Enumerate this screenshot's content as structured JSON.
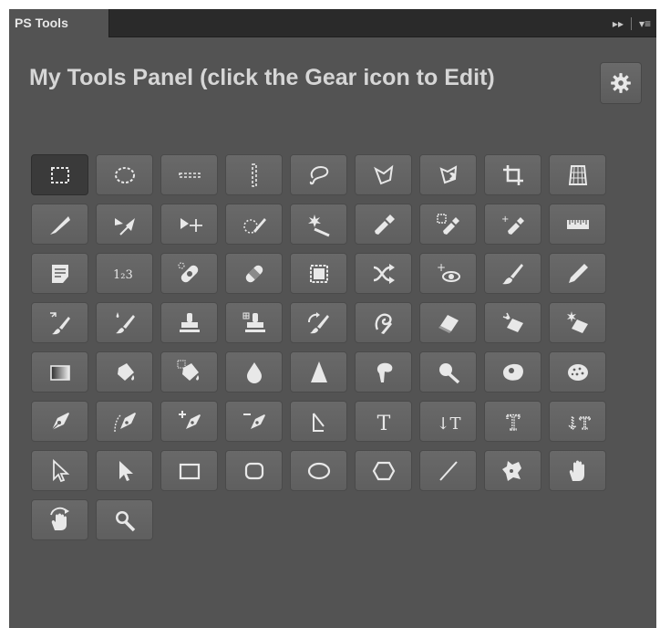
{
  "tab": {
    "label": "PS Tools"
  },
  "tab_controls": {
    "collapse_symbol": "▸▸",
    "menu_symbol": "▾≡"
  },
  "panel": {
    "title": "My Tools Panel (click the Gear icon to Edit)"
  },
  "gear_button": {
    "icon": "gear-icon"
  },
  "tools": [
    {
      "name": "rectangular-marquee",
      "icon": "rect-marquee-icon"
    },
    {
      "name": "elliptical-marquee",
      "icon": "ellipse-marquee-icon"
    },
    {
      "name": "single-row-marquee",
      "icon": "row-marquee-icon"
    },
    {
      "name": "single-column-marquee",
      "icon": "column-marquee-icon"
    },
    {
      "name": "lasso",
      "icon": "lasso-icon"
    },
    {
      "name": "polygonal-lasso",
      "icon": "polygonal-lasso-icon"
    },
    {
      "name": "magnetic-lasso",
      "icon": "magnetic-lasso-icon"
    },
    {
      "name": "crop",
      "icon": "crop-icon"
    },
    {
      "name": "perspective-crop",
      "icon": "perspective-crop-icon"
    },
    {
      "name": "slice",
      "icon": "slice-icon"
    },
    {
      "name": "slice-select",
      "icon": "slice-select-icon"
    },
    {
      "name": "move",
      "icon": "move-icon"
    },
    {
      "name": "quick-selection",
      "icon": "quick-selection-icon"
    },
    {
      "name": "magic-wand",
      "icon": "magic-wand-icon"
    },
    {
      "name": "eyedropper",
      "icon": "eyedropper-icon"
    },
    {
      "name": "color-sampler",
      "icon": "color-sampler-icon"
    },
    {
      "name": "3d-material-eyedropper",
      "icon": "material-eyedropper-icon"
    },
    {
      "name": "ruler",
      "icon": "ruler-icon"
    },
    {
      "name": "note",
      "icon": "note-icon"
    },
    {
      "name": "count",
      "icon": "count-icon",
      "glyph": "1₂3"
    },
    {
      "name": "spot-healing-brush",
      "icon": "spot-healing-icon"
    },
    {
      "name": "healing-brush",
      "icon": "healing-brush-icon"
    },
    {
      "name": "patch",
      "icon": "patch-icon"
    },
    {
      "name": "content-aware-move",
      "icon": "content-aware-move-icon"
    },
    {
      "name": "red-eye",
      "icon": "red-eye-icon"
    },
    {
      "name": "brush",
      "icon": "brush-icon"
    },
    {
      "name": "pencil",
      "icon": "pencil-icon"
    },
    {
      "name": "color-replacement",
      "icon": "color-replacement-icon"
    },
    {
      "name": "mixer-brush",
      "icon": "mixer-brush-icon"
    },
    {
      "name": "clone-stamp",
      "icon": "clone-stamp-icon"
    },
    {
      "name": "pattern-stamp",
      "icon": "pattern-stamp-icon"
    },
    {
      "name": "history-brush",
      "icon": "history-brush-icon"
    },
    {
      "name": "art-history-brush",
      "icon": "art-history-brush-icon"
    },
    {
      "name": "eraser",
      "icon": "eraser-icon"
    },
    {
      "name": "background-eraser",
      "icon": "background-eraser-icon"
    },
    {
      "name": "magic-eraser",
      "icon": "magic-eraser-icon"
    },
    {
      "name": "gradient",
      "icon": "gradient-icon"
    },
    {
      "name": "paint-bucket",
      "icon": "paint-bucket-icon"
    },
    {
      "name": "3d-material-drop",
      "icon": "material-drop-icon"
    },
    {
      "name": "blur",
      "icon": "blur-icon"
    },
    {
      "name": "sharpen",
      "icon": "sharpen-icon"
    },
    {
      "name": "smudge",
      "icon": "smudge-icon"
    },
    {
      "name": "dodge",
      "icon": "dodge-icon"
    },
    {
      "name": "burn",
      "icon": "burn-icon"
    },
    {
      "name": "sponge",
      "icon": "sponge-icon"
    },
    {
      "name": "pen",
      "icon": "pen-icon"
    },
    {
      "name": "freeform-pen",
      "icon": "freeform-pen-icon"
    },
    {
      "name": "add-anchor-point",
      "icon": "add-anchor-icon"
    },
    {
      "name": "delete-anchor-point",
      "icon": "delete-anchor-icon"
    },
    {
      "name": "convert-point",
      "icon": "convert-point-icon"
    },
    {
      "name": "horizontal-type",
      "icon": "horizontal-type-icon",
      "glyph": "T"
    },
    {
      "name": "vertical-type",
      "icon": "vertical-type-icon",
      "glyph": "↓T"
    },
    {
      "name": "horizontal-type-mask",
      "icon": "horizontal-type-mask-icon",
      "glyph": "T"
    },
    {
      "name": "vertical-type-mask",
      "icon": "vertical-type-mask-icon",
      "glyph": "↓T"
    },
    {
      "name": "path-selection",
      "icon": "path-selection-icon"
    },
    {
      "name": "direct-selection",
      "icon": "direct-selection-icon"
    },
    {
      "name": "rectangle",
      "icon": "rectangle-icon"
    },
    {
      "name": "rounded-rectangle",
      "icon": "rounded-rectangle-icon"
    },
    {
      "name": "ellipse",
      "icon": "ellipse-icon"
    },
    {
      "name": "polygon",
      "icon": "polygon-icon"
    },
    {
      "name": "line",
      "icon": "line-icon"
    },
    {
      "name": "custom-shape",
      "icon": "custom-shape-icon"
    },
    {
      "name": "hand",
      "icon": "hand-icon"
    },
    {
      "name": "rotate-view",
      "icon": "rotate-view-icon"
    },
    {
      "name": "zoom",
      "icon": "zoom-icon"
    }
  ],
  "active_tool": "rectangular-marquee",
  "colors": {
    "panel_bg": "#535353",
    "tab_bar_bg": "#2a2a2a",
    "button_bg": "#646464",
    "active_button_bg": "#3a3a3a",
    "icon": "#e8e8e8",
    "title_text": "#d6d6d6"
  }
}
